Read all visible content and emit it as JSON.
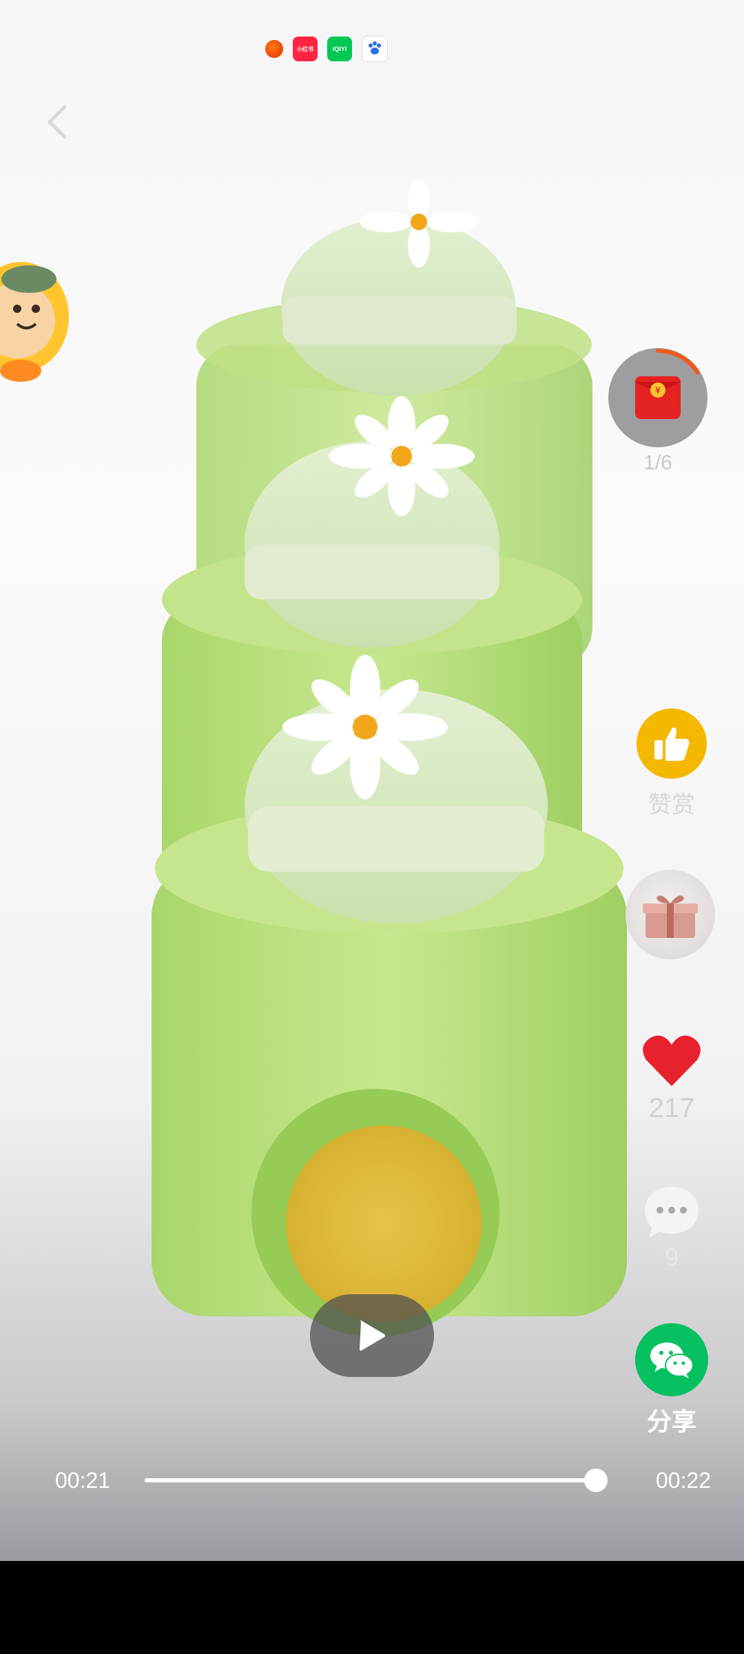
{
  "status_bar": {
    "icons": [
      "taobao-icon",
      "xiaohongshu-icon",
      "iqiyi-icon",
      "baidu-icon"
    ],
    "xiaohongshu_label": "小红书",
    "iqiyi_label": "iQIYI"
  },
  "rail": {
    "redpacket_label": "1/6",
    "redpacket_progress": 0.16,
    "reward_label": "赞赏",
    "like_count": "217",
    "comment_count": "9",
    "share_label": "分享"
  },
  "player": {
    "current_time": "00:21",
    "total_time": "00:22",
    "progress": 0.985
  },
  "colors": {
    "reward": "#f5b800",
    "like": "#e8222d",
    "share": "#07c160",
    "redpacket": "#e52222"
  }
}
